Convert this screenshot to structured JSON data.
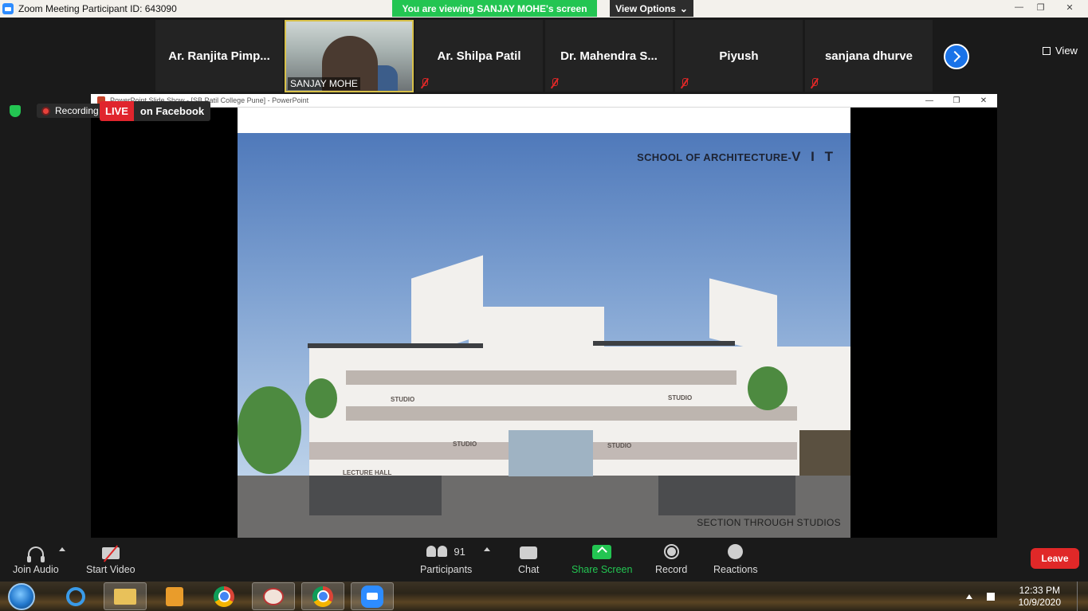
{
  "window": {
    "title": "Zoom Meeting Participant ID: 643090",
    "viewing_banner": "You are viewing SANJAY MOHE's screen",
    "view_options": "View Options",
    "view_label": "View"
  },
  "participants": [
    {
      "name": "Ar. Ranjita Pimp..."
    },
    {
      "name": "SANJAY MOHE"
    },
    {
      "name": "Ar. Shilpa Patil"
    },
    {
      "name": "Dr. Mahendra S..."
    },
    {
      "name": "Piyush"
    },
    {
      "name": "sanjana dhurve"
    }
  ],
  "powerpoint": {
    "title": "PowerPoint Slide Show - [SB Patil College Pune] - PowerPoint"
  },
  "status": {
    "recording": "Recording",
    "live": "LIVE",
    "live_target": "on Facebook"
  },
  "slide": {
    "title_prefix": "SCHOOL OF ARCHITECTURE-",
    "title_suffix": "V I T",
    "caption": "SECTION THROUGH STUDIOS",
    "labels": [
      "STUDIO",
      "STUDIO",
      "STUDIO",
      "STUDIO",
      "LECTURE HALL"
    ]
  },
  "toolbar": {
    "join_audio": "Join Audio",
    "start_video": "Start Video",
    "participants": "Participants",
    "participants_count": "91",
    "chat": "Chat",
    "share_screen": "Share Screen",
    "record": "Record",
    "reactions": "Reactions",
    "leave": "Leave"
  },
  "taskbar": {
    "time": "12:33 PM",
    "date": "10/9/2020"
  },
  "colors": {
    "share_green": "#23c552",
    "leave_red": "#e02828",
    "zoom_blue": "#2d8cff"
  }
}
